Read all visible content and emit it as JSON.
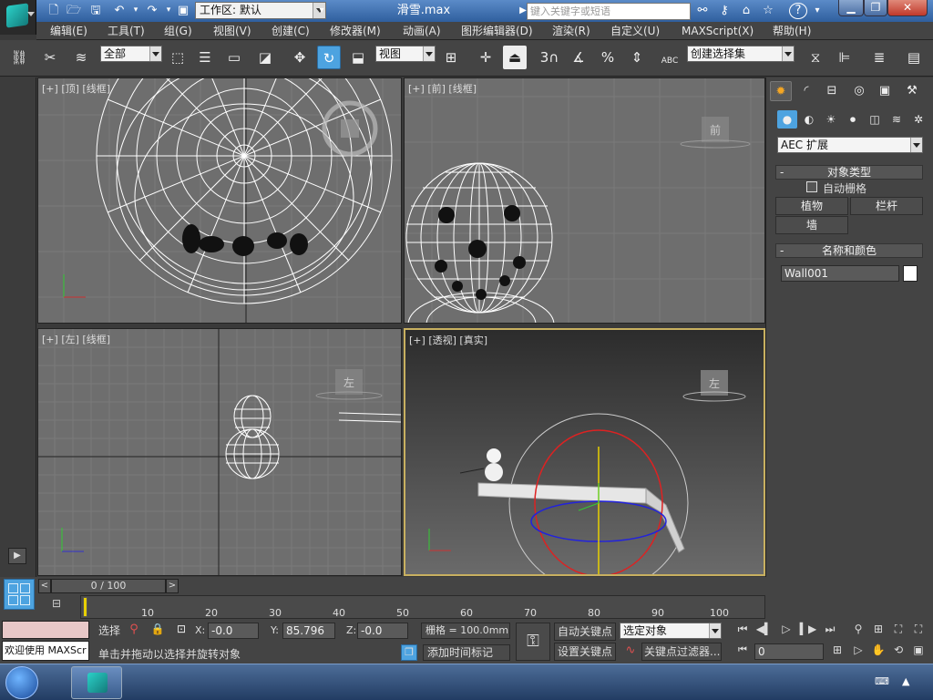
{
  "app": {
    "file_title": "滑雪.max",
    "workspace_label": "工作区: 默认",
    "search_placeholder": "键入关键字或短语",
    "help_icon": "?"
  },
  "menu": [
    "编辑(E)",
    "工具(T)",
    "组(G)",
    "视图(V)",
    "创建(C)",
    "修改器(M)",
    "动画(A)",
    "图形编辑器(D)",
    "渲染(R)",
    "自定义(U)",
    "MAXScript(X)",
    "帮助(H)"
  ],
  "toolbar": {
    "filter_value": "全部",
    "refcoord_value": "视图",
    "named_selection_placeholder": "创建选择集",
    "snap_3": "3",
    "percent": "%",
    "abc": "ABC"
  },
  "viewports": {
    "top": {
      "label_plus": "[+]",
      "label_view": "[顶]",
      "label_shade": "[线框]"
    },
    "front": {
      "label_plus": "[+]",
      "label_view": "[前]",
      "label_shade": "[线框]",
      "cube_text": "前"
    },
    "left": {
      "label_plus": "[+]",
      "label_view": "[左]",
      "label_shade": "[线框]",
      "cube_text": "左"
    },
    "persp": {
      "label_plus": "[+]",
      "label_view": "[透视]",
      "label_shade": "[真实]",
      "cube_text": "左"
    }
  },
  "command_panel": {
    "category_dropdown": "AEC 扩展",
    "object_type_header": "对象类型",
    "autogrid_label": "自动栅格",
    "buttons": [
      "植物",
      "栏杆",
      "墙"
    ],
    "name_color_header": "名称和颜色",
    "object_name": "Wall001",
    "object_color": "#ffffff"
  },
  "timeline": {
    "slider_text": "0 / 100",
    "ticks": [
      "10",
      "20",
      "30",
      "40",
      "50",
      "60",
      "70",
      "80",
      "90",
      "100"
    ]
  },
  "status": {
    "maxscript_text": "欢迎使用 MAXScr",
    "select_label": "选择",
    "x_label": "X:",
    "x_value": "-0.0",
    "y_label": "Y:",
    "y_value": "85.796",
    "z_label": "Z:",
    "z_value": "-0.0",
    "grid_text": "栅格 = 100.0mm",
    "prompt": "单击并拖动以选择并旋转对象",
    "add_time_tag": "添加时间标记",
    "auto_key": "自动关键点",
    "set_key": "设置关键点",
    "key_mode_dropdown": "选定对象",
    "key_filters": "关键点过滤器...",
    "frame_value": "0"
  },
  "colors": {
    "accent": "#4da3e0",
    "active_border": "#c8b060"
  }
}
